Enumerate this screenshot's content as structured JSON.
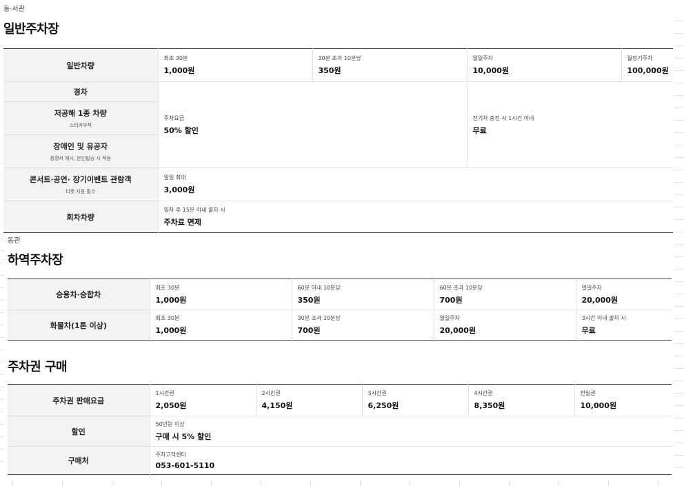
{
  "section1": {
    "subtitle": "동·서관",
    "title": "일반주차장",
    "row_general": {
      "header": "일반차량",
      "cells": [
        {
          "label": "최초 30분",
          "value": "1,000원"
        },
        {
          "label": "30분 초과 10분당",
          "value": "350원"
        },
        {
          "label": "일일주차",
          "value": "10,000원"
        },
        {
          "label": "월정기주차",
          "value": "100,000원"
        }
      ]
    },
    "row_compact": {
      "header": "경차"
    },
    "row_lowpollution": {
      "header": "저공해 1종 차량",
      "note": "스티커부착"
    },
    "row_disabled": {
      "header": "장애인 및 유공자",
      "note": "증명서 제시, 본인탑승 시 적용"
    },
    "discount": {
      "label": "주차요금",
      "value": "50% 할인"
    },
    "ev": {
      "label": "전기차 충전 시 1시간 이내",
      "value": "무료"
    },
    "row_concert": {
      "header": "콘서트·공연· 장기이벤트 관람객",
      "note": "티켓 지참 필수",
      "label": "일일 최대",
      "value": "3,000원"
    },
    "row_turn": {
      "header": "회차차량",
      "label": "입차 후 15분 이내 출차 시",
      "value": "주차료 면제"
    }
  },
  "section2": {
    "subtitle": "동관",
    "title": "하역주차장",
    "rows": [
      {
        "header": "승용차·승합차",
        "cells": [
          {
            "label": "최초 30분",
            "value": "1,000원"
          },
          {
            "label": "60분 이내 10분당",
            "value": "350원"
          },
          {
            "label": "60분 초과 10분당",
            "value": "700원"
          },
          {
            "label": "일일주차",
            "value": "20,000원"
          }
        ]
      },
      {
        "header": "화물차(1톤 이상)",
        "cells": [
          {
            "label": "최초 30분",
            "value": "1,000원"
          },
          {
            "label": "30분 초과 10분당",
            "value": "700원"
          },
          {
            "label": "일일주차",
            "value": "20,000원"
          },
          {
            "label": "3시간 이내 출차 시",
            "value": "무료"
          }
        ]
      }
    ]
  },
  "section3": {
    "title": "주차권 구매",
    "row_price": {
      "header": "주차권 판매요금",
      "cells": [
        {
          "label": "1시간권",
          "value": "2,050원"
        },
        {
          "label": "2시간권",
          "value": "4,150원"
        },
        {
          "label": "3시간권",
          "value": "6,250원"
        },
        {
          "label": "4시간권",
          "value": "8,350원"
        },
        {
          "label": "전일권",
          "value": "10,000원"
        }
      ]
    },
    "row_discount": {
      "header": "할인",
      "label": "50만원 이상",
      "value": "구매 시 5% 할인"
    },
    "row_where": {
      "header": "구매처",
      "label": "주차고객센터",
      "value": "053-601-5110"
    }
  }
}
